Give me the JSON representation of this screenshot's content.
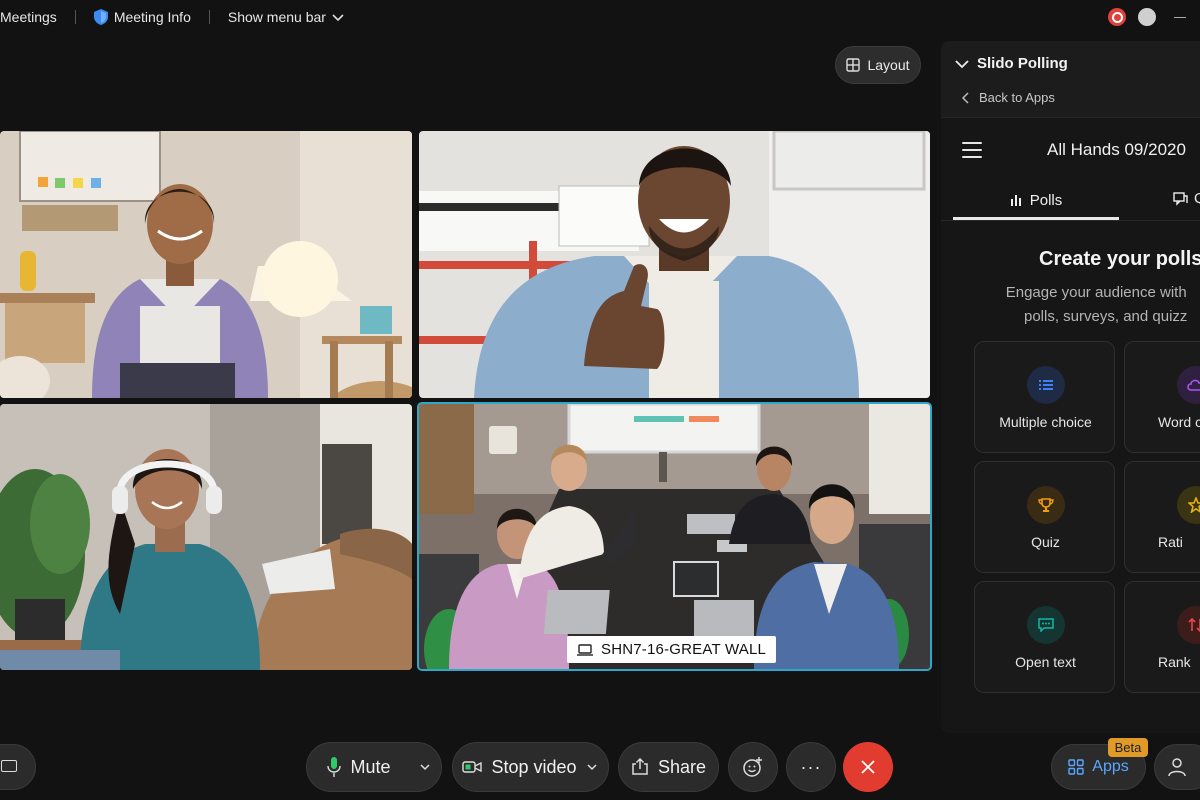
{
  "topbar": {
    "app_name": "Meetings",
    "meeting_info": "Meeting Info",
    "show_menu_bar": "Show menu bar"
  },
  "layout_button": {
    "label": "Layout"
  },
  "tiles": {
    "room_label": "SHN7-16-GREAT WALL"
  },
  "panel": {
    "title": "Slido Polling",
    "back_label": "Back to Apps",
    "event_title": "All Hands 09/2020",
    "tabs": [
      {
        "label": "Polls",
        "active": true
      },
      {
        "label": "Q",
        "active": false
      }
    ],
    "create_title": "Create your polls",
    "create_subtitle_line1": "Engage your audience with",
    "create_subtitle_line2": "polls, surveys, and quizz",
    "poll_types": [
      {
        "label": "Multiple choice",
        "icon": "list-icon",
        "color": "#3b82f6"
      },
      {
        "label": "Word c",
        "icon": "cloud-icon",
        "color": "#a855f7"
      },
      {
        "label": "Quiz",
        "icon": "trophy-icon",
        "color": "#f59e0b"
      },
      {
        "label": "Rati",
        "icon": "star-icon",
        "color": "#eab308"
      },
      {
        "label": "Open text",
        "icon": "chat-icon",
        "color": "#14b8a6"
      },
      {
        "label": "Rank",
        "icon": "sort-icon",
        "color": "#ef4444"
      }
    ]
  },
  "controls": {
    "mute_label": "Mute",
    "stop_video_label": "Stop video",
    "share_label": "Share",
    "more_label": "···",
    "apps_label": "Apps",
    "beta_label": "Beta"
  },
  "colors": {
    "active_speaker_border": "#2fa7c9",
    "end_call": "#e23c30",
    "apps_accent": "#5aa8ff",
    "beta_badge": "#e19a27"
  }
}
